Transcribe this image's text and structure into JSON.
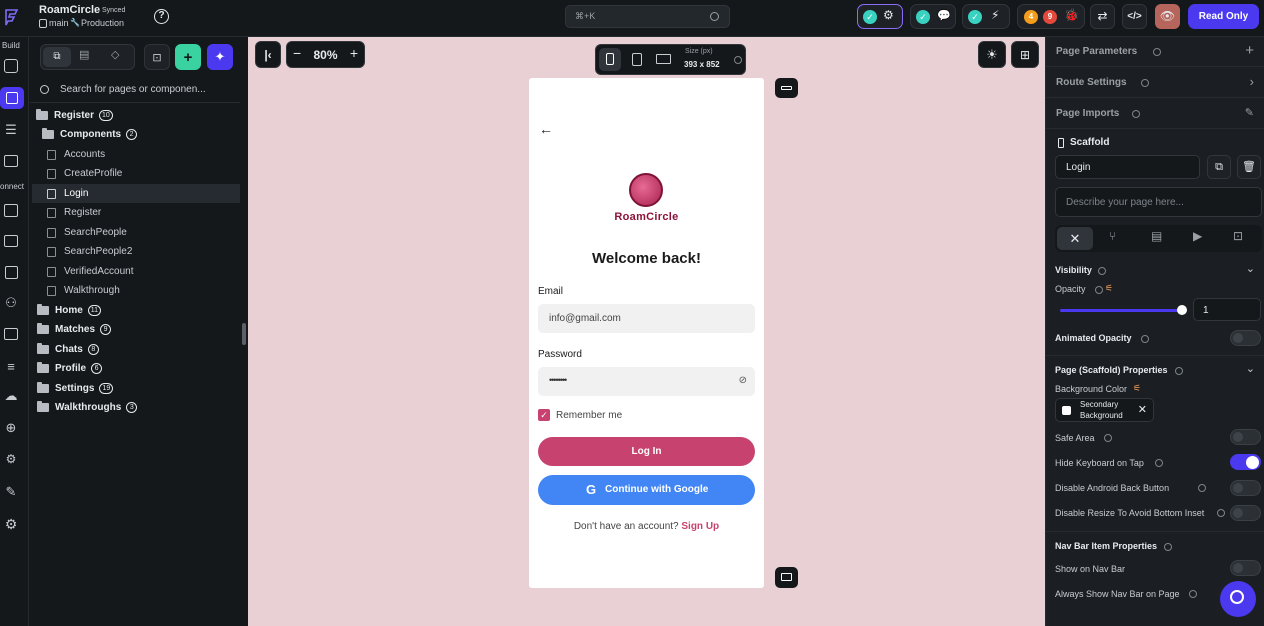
{
  "app": {
    "project_name": "RoamCircle",
    "sync_status": "Synced",
    "branch": "main",
    "environment": "Production",
    "search_shortcut": "⌘+K",
    "notif_orange": "4",
    "notif_red": "9",
    "read_only_label": "Read Only"
  },
  "rail": {
    "build_label": "Build",
    "connect_label": "onnect"
  },
  "left": {
    "search_placeholder": "Search for pages or componen...",
    "tree": [
      {
        "label": "Register",
        "count": "10"
      },
      {
        "label": "Components",
        "count": "2"
      },
      {
        "label": "Accounts"
      },
      {
        "label": "CreateProfile"
      },
      {
        "label": "Login"
      },
      {
        "label": "Register"
      },
      {
        "label": "SearchPeople"
      },
      {
        "label": "SearchPeople2"
      },
      {
        "label": "VerifiedAccount"
      },
      {
        "label": "Walkthrough"
      },
      {
        "label": "Home",
        "count": "11"
      },
      {
        "label": "Matches",
        "count": "9"
      },
      {
        "label": "Chats",
        "count": "8"
      },
      {
        "label": "Profile",
        "count": "6"
      },
      {
        "label": "Settings",
        "count": "19"
      },
      {
        "label": "Walkthroughs",
        "count": "3"
      }
    ]
  },
  "toolbar": {
    "zoom": "80%",
    "size_label": "Size (px)",
    "size_value": "393 x 852"
  },
  "phone": {
    "brand": "RoamCircle",
    "welcome": "Welcome back!",
    "email_label": "Email",
    "email_value": "info@gmail.com",
    "password_label": "Password",
    "password_value": "••••••••",
    "remember_label": "Remember me",
    "login_label": "Log In",
    "google_label": "Continue with Google",
    "no_account": "Don't have an account?",
    "signup": "Sign Up",
    "brand_color": "#c7426f",
    "google_color": "#4285f4"
  },
  "right": {
    "page_parameters": "Page Parameters",
    "route_settings": "Route Settings",
    "page_imports": "Page Imports",
    "scaffold": "Scaffold",
    "page_name": "Login",
    "describe_placeholder": "Describe your page here...",
    "visibility": "Visibility",
    "opacity": "Opacity",
    "opacity_value": "1",
    "animated_opacity": "Animated Opacity",
    "scaffold_props": "Page (Scaffold) Properties",
    "background_color": "Background Color",
    "bg_value_1": "Secondary",
    "bg_value_2": "Background",
    "safe_area": "Safe Area",
    "hide_keyboard": "Hide Keyboard on Tap",
    "disable_android_back": "Disable Android Back Button",
    "disable_resize": "Disable Resize To Avoid Bottom Inset",
    "nav_bar_props": "Nav Bar Item Properties",
    "show_nav_bar": "Show on Nav Bar",
    "always_show_nav": "Always Show Nav Bar on Page"
  }
}
